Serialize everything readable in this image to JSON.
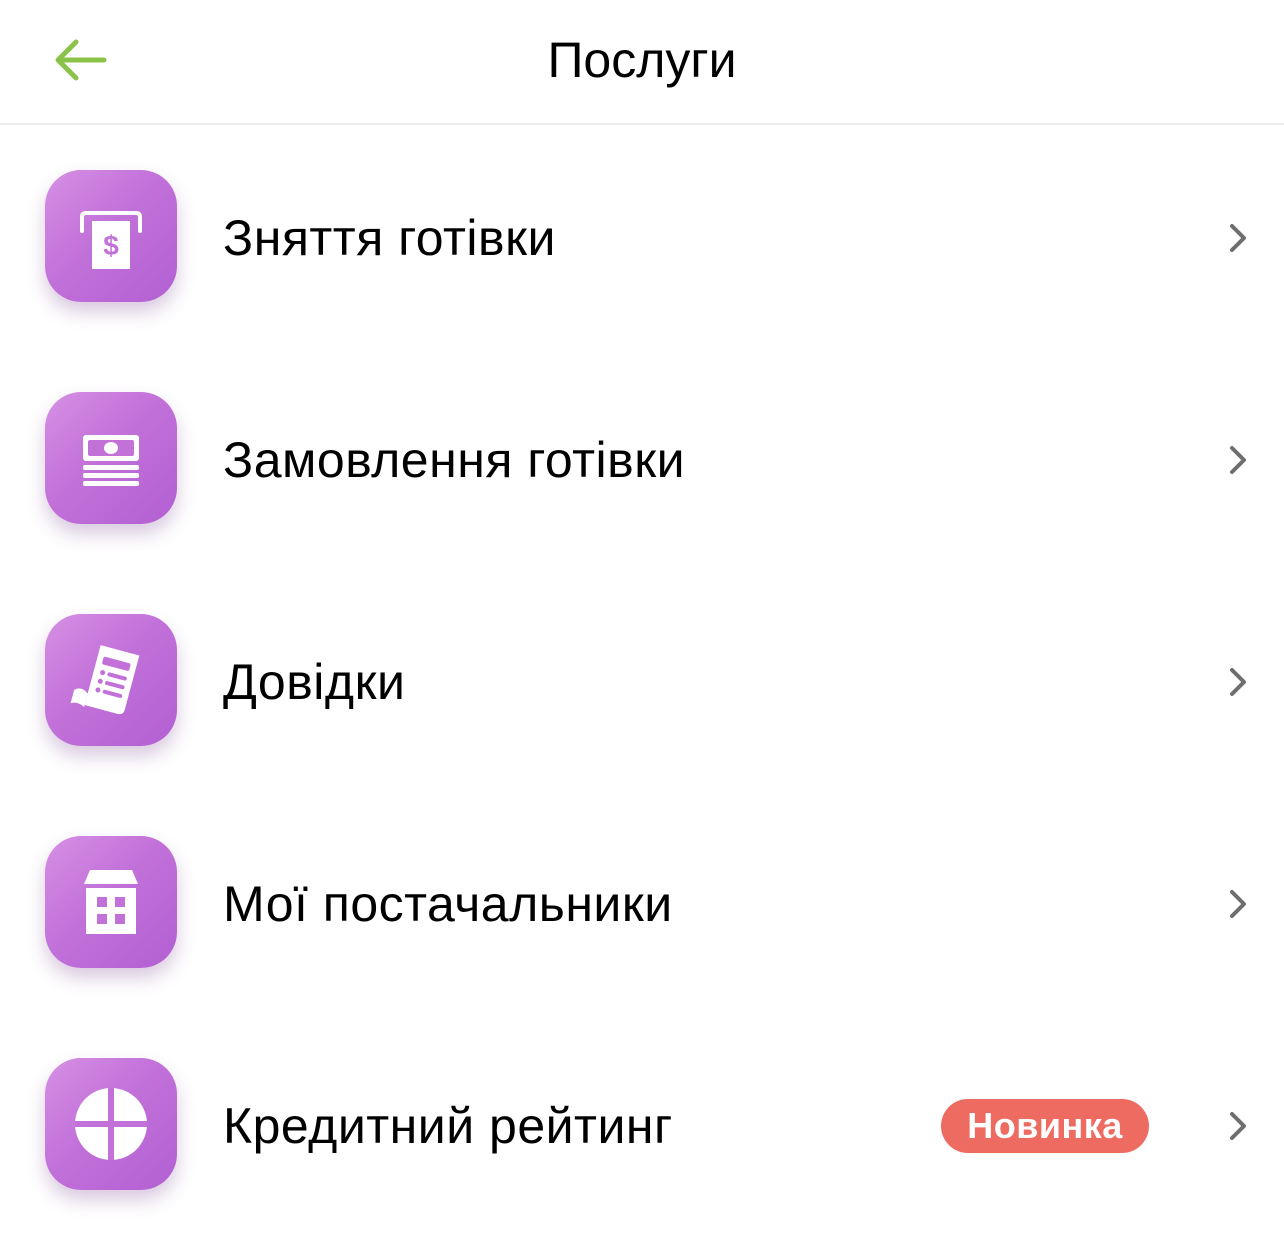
{
  "header": {
    "title": "Послуги",
    "back_icon": "arrow-left-icon",
    "accent_color": "#8bc34a"
  },
  "services": {
    "items": [
      {
        "label": "Зняття готівки",
        "icon": "atm-cash-icon"
      },
      {
        "label": "Замовлення готівки",
        "icon": "cash-stack-icon"
      },
      {
        "label": "Довідки",
        "icon": "document-icon"
      },
      {
        "label": "Мої постачальники",
        "icon": "building-icon"
      },
      {
        "label": "Кредитний рейтинг",
        "icon": "rating-circle-icon",
        "badge": "Новинка"
      }
    ],
    "icon_color": "#c271d9",
    "badge_color": "#ee6b61"
  }
}
